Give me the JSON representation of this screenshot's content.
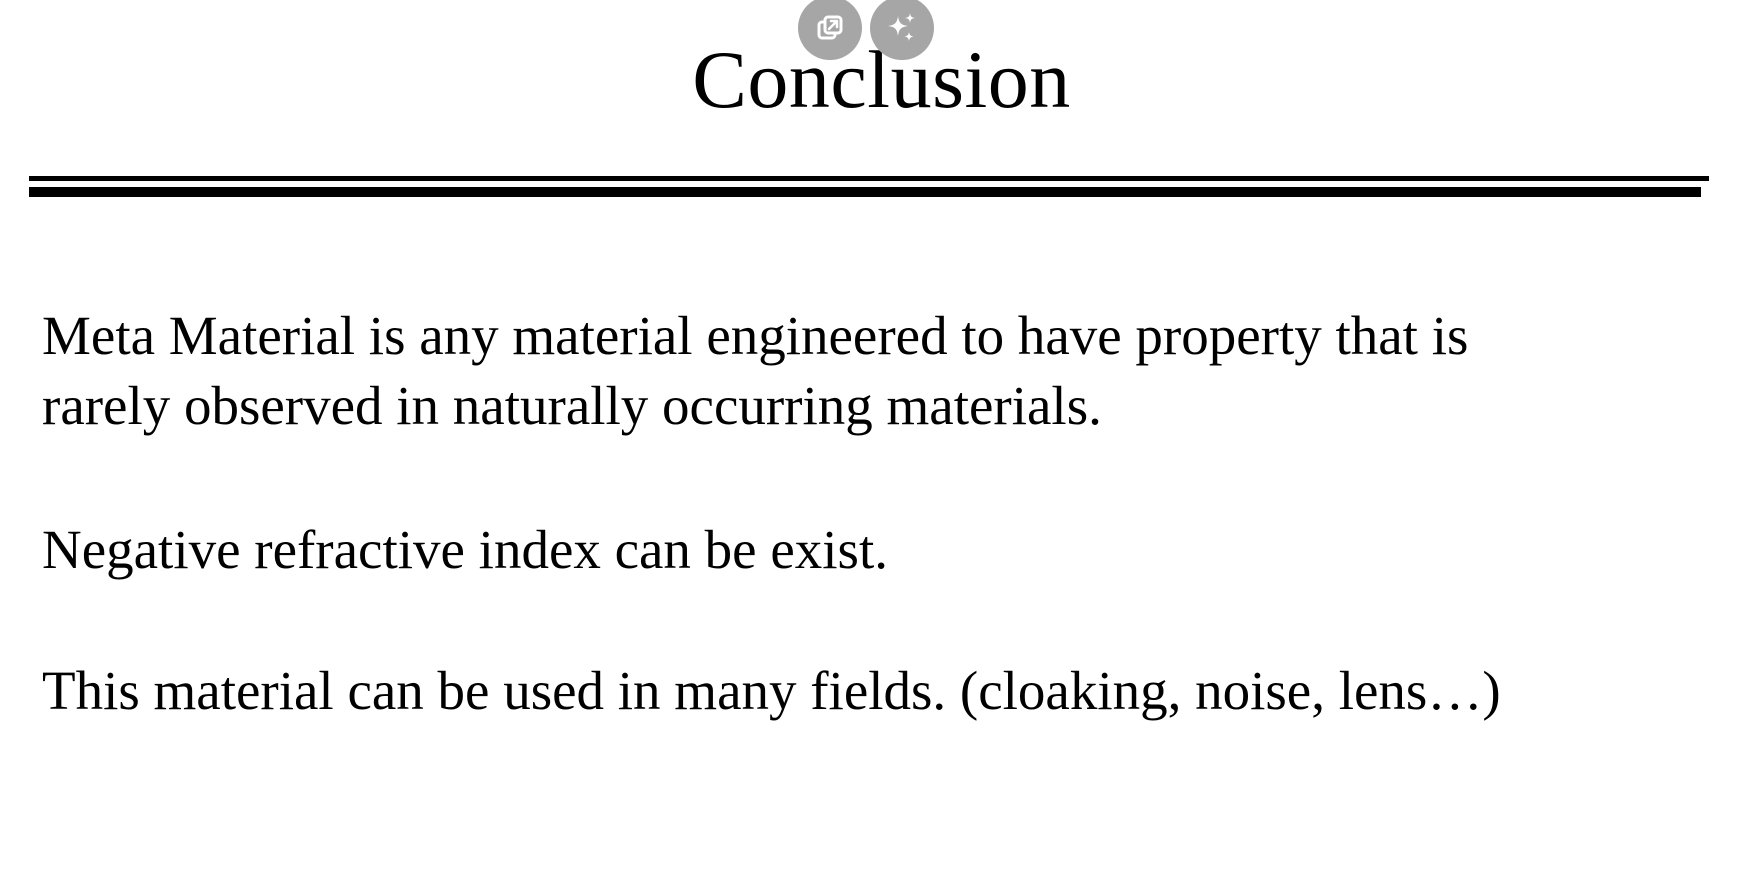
{
  "slide": {
    "title": "Conclusion",
    "paragraphs": [
      {
        "lines": [
          "Meta Material is any material engineered to have property that is",
          "rarely observed in naturally occurring materials."
        ]
      },
      {
        "lines": [
          "Negative refractive index can be exist."
        ]
      },
      {
        "lines": [
          "This material can be used in many fields.  (cloaking, noise, lens…)"
        ]
      }
    ]
  },
  "overlay": {
    "buttons": [
      {
        "icon": "open-external-icon"
      },
      {
        "icon": "sparkle-icon"
      }
    ],
    "color": "#a6a6a6"
  }
}
